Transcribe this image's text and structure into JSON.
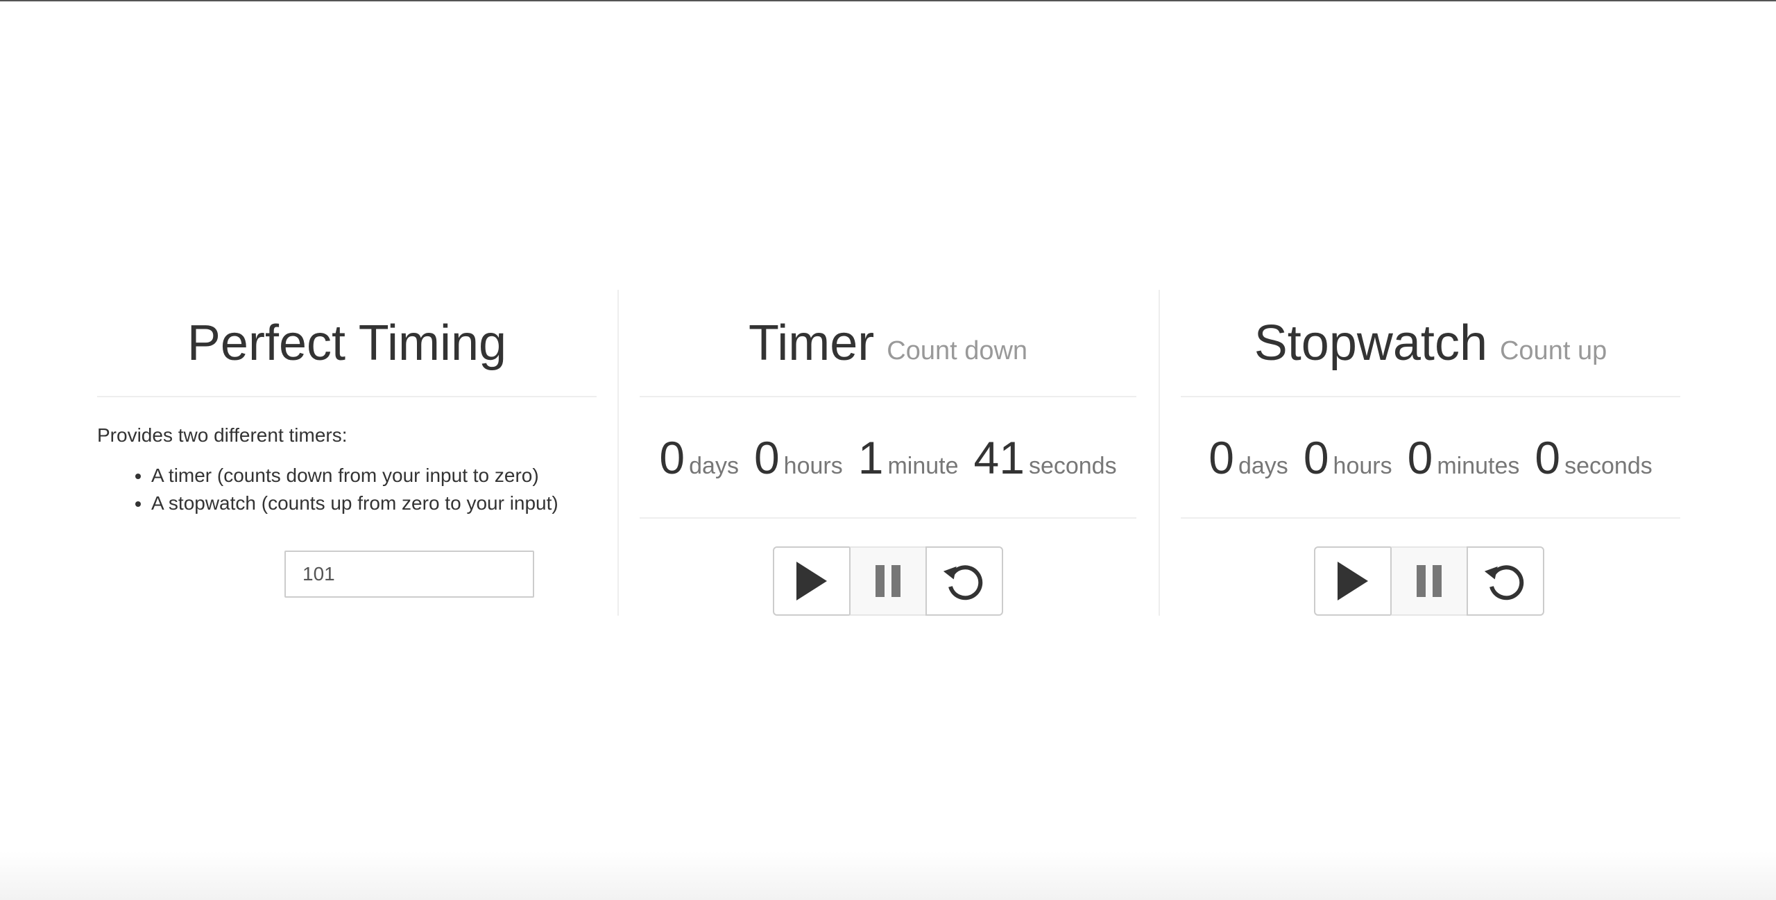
{
  "intro": {
    "title": "Perfect Timing",
    "description": "Provides two different timers:",
    "features": [
      "A timer (counts down from your input to zero)",
      "A stopwatch (counts up from zero to your input)"
    ],
    "input_value": "101"
  },
  "timer": {
    "title": "Timer",
    "subtitle": "Count down",
    "units": [
      {
        "value": "0",
        "label": "days"
      },
      {
        "value": "0",
        "label": "hours"
      },
      {
        "value": "1",
        "label": "minute"
      },
      {
        "value": "41",
        "label": "seconds"
      }
    ]
  },
  "stopwatch": {
    "title": "Stopwatch",
    "subtitle": "Count up",
    "units": [
      {
        "value": "0",
        "label": "days"
      },
      {
        "value": "0",
        "label": "hours"
      },
      {
        "value": "0",
        "label": "minutes"
      },
      {
        "value": "0",
        "label": "seconds"
      }
    ]
  },
  "icons": {
    "play": "play-icon",
    "pause": "pause-icon",
    "reset": "reset-icon"
  },
  "colors": {
    "icon_dark": "#333333",
    "icon_pause": "#777777",
    "subtitle": "#999999"
  }
}
